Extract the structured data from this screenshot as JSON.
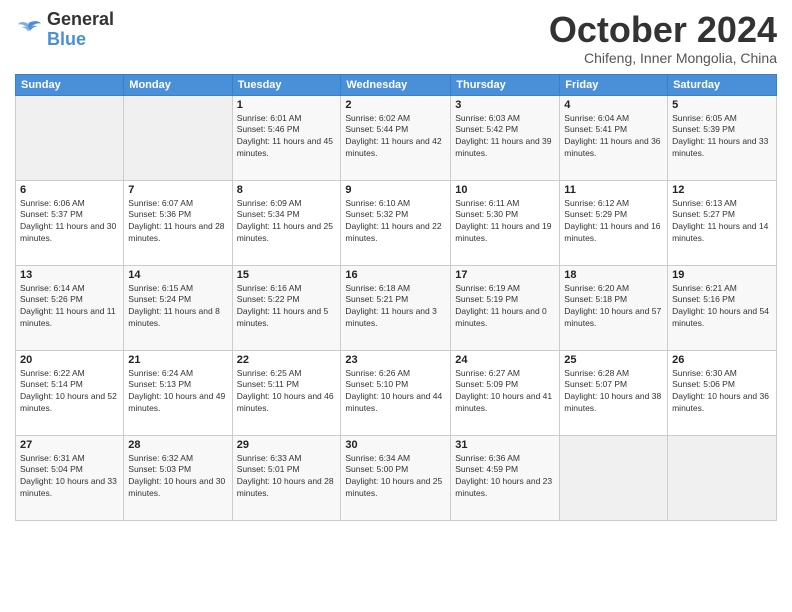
{
  "logo": {
    "line1": "General",
    "line2": "Blue"
  },
  "header": {
    "month": "October 2024",
    "location": "Chifeng, Inner Mongolia, China"
  },
  "days_of_week": [
    "Sunday",
    "Monday",
    "Tuesday",
    "Wednesday",
    "Thursday",
    "Friday",
    "Saturday"
  ],
  "weeks": [
    [
      {
        "day": "",
        "sunrise": "",
        "sunset": "",
        "daylight": ""
      },
      {
        "day": "",
        "sunrise": "",
        "sunset": "",
        "daylight": ""
      },
      {
        "day": "1",
        "sunrise": "Sunrise: 6:01 AM",
        "sunset": "Sunset: 5:46 PM",
        "daylight": "Daylight: 11 hours and 45 minutes."
      },
      {
        "day": "2",
        "sunrise": "Sunrise: 6:02 AM",
        "sunset": "Sunset: 5:44 PM",
        "daylight": "Daylight: 11 hours and 42 minutes."
      },
      {
        "day": "3",
        "sunrise": "Sunrise: 6:03 AM",
        "sunset": "Sunset: 5:42 PM",
        "daylight": "Daylight: 11 hours and 39 minutes."
      },
      {
        "day": "4",
        "sunrise": "Sunrise: 6:04 AM",
        "sunset": "Sunset: 5:41 PM",
        "daylight": "Daylight: 11 hours and 36 minutes."
      },
      {
        "day": "5",
        "sunrise": "Sunrise: 6:05 AM",
        "sunset": "Sunset: 5:39 PM",
        "daylight": "Daylight: 11 hours and 33 minutes."
      }
    ],
    [
      {
        "day": "6",
        "sunrise": "Sunrise: 6:06 AM",
        "sunset": "Sunset: 5:37 PM",
        "daylight": "Daylight: 11 hours and 30 minutes."
      },
      {
        "day": "7",
        "sunrise": "Sunrise: 6:07 AM",
        "sunset": "Sunset: 5:36 PM",
        "daylight": "Daylight: 11 hours and 28 minutes."
      },
      {
        "day": "8",
        "sunrise": "Sunrise: 6:09 AM",
        "sunset": "Sunset: 5:34 PM",
        "daylight": "Daylight: 11 hours and 25 minutes."
      },
      {
        "day": "9",
        "sunrise": "Sunrise: 6:10 AM",
        "sunset": "Sunset: 5:32 PM",
        "daylight": "Daylight: 11 hours and 22 minutes."
      },
      {
        "day": "10",
        "sunrise": "Sunrise: 6:11 AM",
        "sunset": "Sunset: 5:30 PM",
        "daylight": "Daylight: 11 hours and 19 minutes."
      },
      {
        "day": "11",
        "sunrise": "Sunrise: 6:12 AM",
        "sunset": "Sunset: 5:29 PM",
        "daylight": "Daylight: 11 hours and 16 minutes."
      },
      {
        "day": "12",
        "sunrise": "Sunrise: 6:13 AM",
        "sunset": "Sunset: 5:27 PM",
        "daylight": "Daylight: 11 hours and 14 minutes."
      }
    ],
    [
      {
        "day": "13",
        "sunrise": "Sunrise: 6:14 AM",
        "sunset": "Sunset: 5:26 PM",
        "daylight": "Daylight: 11 hours and 11 minutes."
      },
      {
        "day": "14",
        "sunrise": "Sunrise: 6:15 AM",
        "sunset": "Sunset: 5:24 PM",
        "daylight": "Daylight: 11 hours and 8 minutes."
      },
      {
        "day": "15",
        "sunrise": "Sunrise: 6:16 AM",
        "sunset": "Sunset: 5:22 PM",
        "daylight": "Daylight: 11 hours and 5 minutes."
      },
      {
        "day": "16",
        "sunrise": "Sunrise: 6:18 AM",
        "sunset": "Sunset: 5:21 PM",
        "daylight": "Daylight: 11 hours and 3 minutes."
      },
      {
        "day": "17",
        "sunrise": "Sunrise: 6:19 AM",
        "sunset": "Sunset: 5:19 PM",
        "daylight": "Daylight: 11 hours and 0 minutes."
      },
      {
        "day": "18",
        "sunrise": "Sunrise: 6:20 AM",
        "sunset": "Sunset: 5:18 PM",
        "daylight": "Daylight: 10 hours and 57 minutes."
      },
      {
        "day": "19",
        "sunrise": "Sunrise: 6:21 AM",
        "sunset": "Sunset: 5:16 PM",
        "daylight": "Daylight: 10 hours and 54 minutes."
      }
    ],
    [
      {
        "day": "20",
        "sunrise": "Sunrise: 6:22 AM",
        "sunset": "Sunset: 5:14 PM",
        "daylight": "Daylight: 10 hours and 52 minutes."
      },
      {
        "day": "21",
        "sunrise": "Sunrise: 6:24 AM",
        "sunset": "Sunset: 5:13 PM",
        "daylight": "Daylight: 10 hours and 49 minutes."
      },
      {
        "day": "22",
        "sunrise": "Sunrise: 6:25 AM",
        "sunset": "Sunset: 5:11 PM",
        "daylight": "Daylight: 10 hours and 46 minutes."
      },
      {
        "day": "23",
        "sunrise": "Sunrise: 6:26 AM",
        "sunset": "Sunset: 5:10 PM",
        "daylight": "Daylight: 10 hours and 44 minutes."
      },
      {
        "day": "24",
        "sunrise": "Sunrise: 6:27 AM",
        "sunset": "Sunset: 5:09 PM",
        "daylight": "Daylight: 10 hours and 41 minutes."
      },
      {
        "day": "25",
        "sunrise": "Sunrise: 6:28 AM",
        "sunset": "Sunset: 5:07 PM",
        "daylight": "Daylight: 10 hours and 38 minutes."
      },
      {
        "day": "26",
        "sunrise": "Sunrise: 6:30 AM",
        "sunset": "Sunset: 5:06 PM",
        "daylight": "Daylight: 10 hours and 36 minutes."
      }
    ],
    [
      {
        "day": "27",
        "sunrise": "Sunrise: 6:31 AM",
        "sunset": "Sunset: 5:04 PM",
        "daylight": "Daylight: 10 hours and 33 minutes."
      },
      {
        "day": "28",
        "sunrise": "Sunrise: 6:32 AM",
        "sunset": "Sunset: 5:03 PM",
        "daylight": "Daylight: 10 hours and 30 minutes."
      },
      {
        "day": "29",
        "sunrise": "Sunrise: 6:33 AM",
        "sunset": "Sunset: 5:01 PM",
        "daylight": "Daylight: 10 hours and 28 minutes."
      },
      {
        "day": "30",
        "sunrise": "Sunrise: 6:34 AM",
        "sunset": "Sunset: 5:00 PM",
        "daylight": "Daylight: 10 hours and 25 minutes."
      },
      {
        "day": "31",
        "sunrise": "Sunrise: 6:36 AM",
        "sunset": "Sunset: 4:59 PM",
        "daylight": "Daylight: 10 hours and 23 minutes."
      },
      {
        "day": "",
        "sunrise": "",
        "sunset": "",
        "daylight": ""
      },
      {
        "day": "",
        "sunrise": "",
        "sunset": "",
        "daylight": ""
      }
    ]
  ]
}
